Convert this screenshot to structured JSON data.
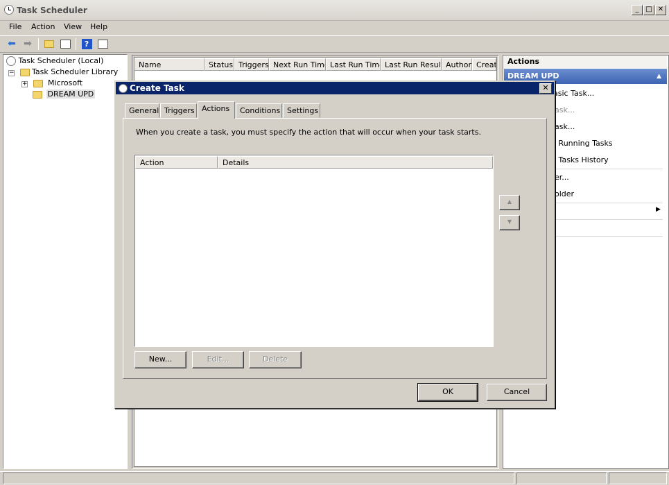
{
  "window": {
    "title": "Task Scheduler",
    "controls": {
      "minimize": "_",
      "maximize": "□",
      "close": "✕"
    }
  },
  "menu": [
    "File",
    "Action",
    "View",
    "Help"
  ],
  "toolbar": {
    "icons": [
      "back-arrow-icon",
      "forward-arrow-icon",
      "up-folder-icon",
      "show-hide-console-tree-icon",
      "help-icon",
      "show-action-pane-icon"
    ]
  },
  "tree": {
    "root": "Task Scheduler (Local)",
    "library": "Task Scheduler Library",
    "microsoft": "Microsoft",
    "dream": "DREAM UPD",
    "expand_minus": "−",
    "expand_plus": "+"
  },
  "task_list": {
    "columns": [
      "Name",
      "Status",
      "Triggers",
      "Next Run Time",
      "Last Run Time",
      "Last Run Result",
      "Author",
      "Creat"
    ]
  },
  "actions_pane": {
    "title": "Actions",
    "group": "DREAM UPD",
    "group_arrow": "▲",
    "items": [
      "asic Task...",
      "ask...",
      "ask...",
      "l Running Tasks",
      "l Tasks History",
      "er...",
      "older"
    ],
    "submenu_arrow": "▶"
  },
  "dialog": {
    "title": "Create Task",
    "close": "✕",
    "tabs": [
      "General",
      "Triggers",
      "Actions",
      "Conditions",
      "Settings"
    ],
    "active_tab": "Actions",
    "description": "When you create a task, you must specify the action that will occur when your task starts.",
    "table_columns": [
      "Action",
      "Details"
    ],
    "buttons": {
      "new": "New...",
      "edit": "Edit...",
      "delete": "Delete"
    },
    "move_up": "▲",
    "move_down": "▼",
    "ok": "OK",
    "cancel": "Cancel"
  }
}
